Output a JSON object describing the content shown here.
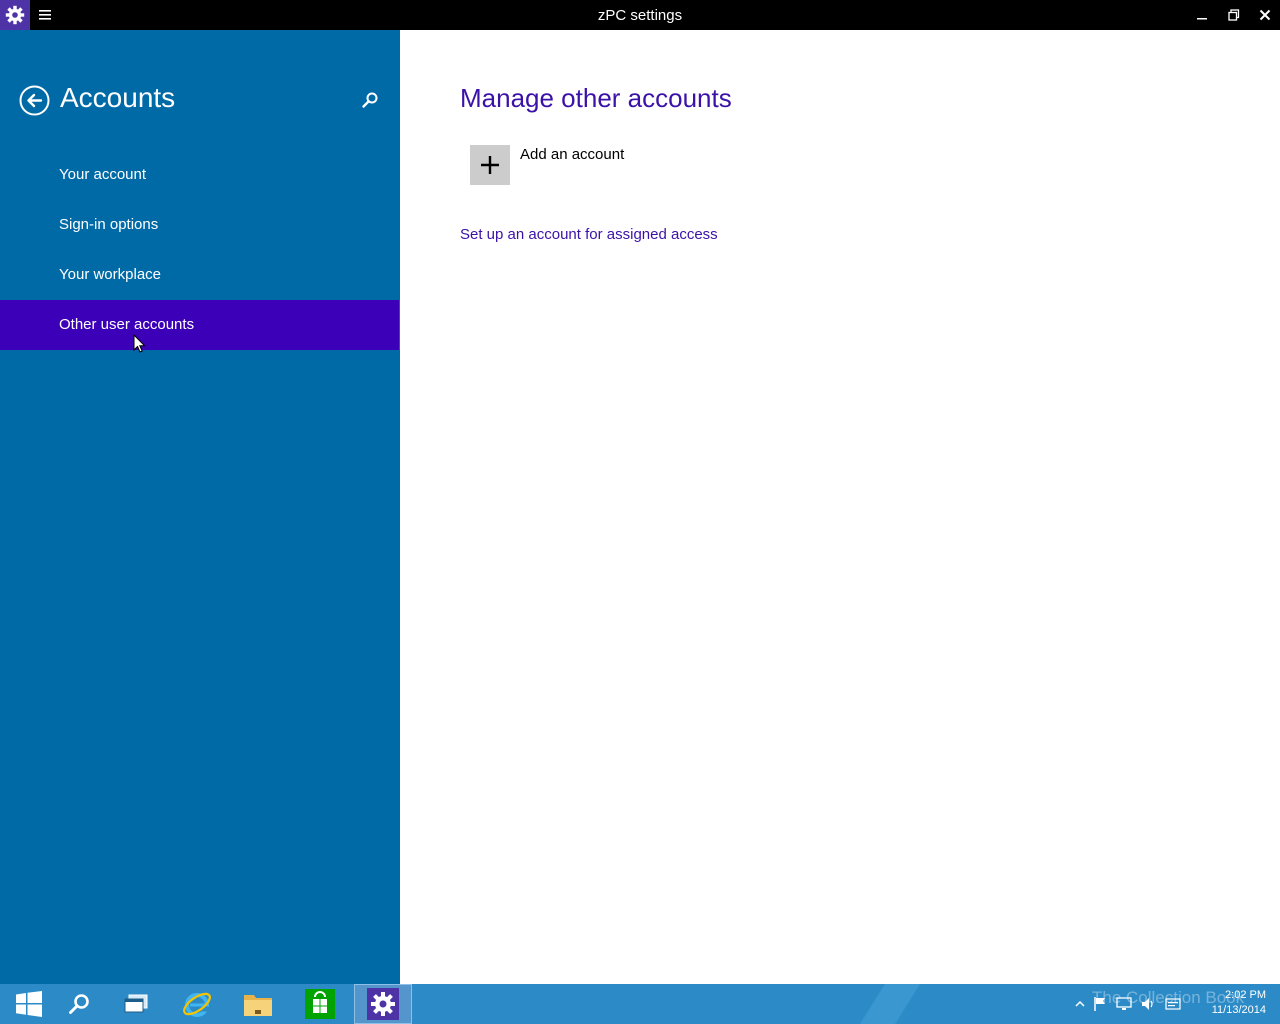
{
  "window": {
    "title": "zPC settings"
  },
  "sidebar": {
    "heading": "Accounts",
    "items": [
      {
        "label": "Your account",
        "selected": false
      },
      {
        "label": "Sign-in options",
        "selected": false
      },
      {
        "label": "Your workplace",
        "selected": false
      },
      {
        "label": "Other user accounts",
        "selected": true
      }
    ]
  },
  "main": {
    "heading": "Manage other accounts",
    "add_account_label": "Add an account",
    "assigned_access_link": "Set up an account for assigned access"
  },
  "taskbar": {
    "apps": [
      "start-icon",
      "search-icon",
      "task-view-icon",
      "internet-explorer-icon",
      "file-explorer-icon",
      "store-icon",
      "settings-icon"
    ],
    "active_app": "settings-icon",
    "watermark": "The Collection Book",
    "time": "2:02 PM",
    "date": "11/13/2014"
  },
  "colors": {
    "sidebar": "#006aa7",
    "selected": "#3b00b8",
    "accent_text": "#3b12a8",
    "taskbar": "#2c8bc7",
    "titlebar": "#000000"
  }
}
